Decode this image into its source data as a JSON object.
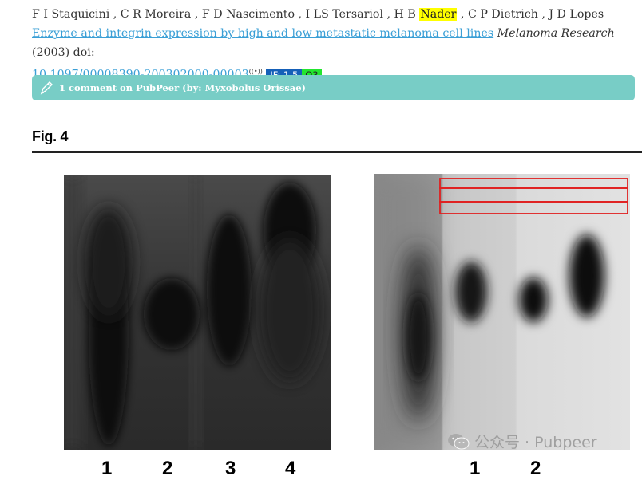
{
  "citation": {
    "authors_before": "F I Staquicini , C R Moreira , F D Nascimento , I LS Tersariol , H B ",
    "highlighted_author": "Nader",
    "authors_after": " , C P Dietrich , J D Lopes ",
    "title_link": "Enzyme and integrin expression by high and low metastatic melanoma cell lines",
    "journal": "Melanoma Research",
    "year_doi_text": " (2003) doi:",
    "doi": "10.1097/00008390-200302000-00003",
    "impact_factor": "IF: 1.5",
    "quartile": "Q3"
  },
  "pubpeer": {
    "label": "1 comment on PubPeer (by: Myxobolus Orissae)",
    "bar_color": "#78cdc6",
    "icon": "pencil-quill-icon"
  },
  "figure": {
    "title": "Fig. 4",
    "left_panel_lanes": [
      "1",
      "2",
      "3",
      "4"
    ],
    "right_panel_lanes": [
      "1",
      "2"
    ],
    "annotation_color": "#e02020"
  },
  "watermark": {
    "icon": "wechat-icon",
    "text": "公众号 · Pubpeer"
  }
}
